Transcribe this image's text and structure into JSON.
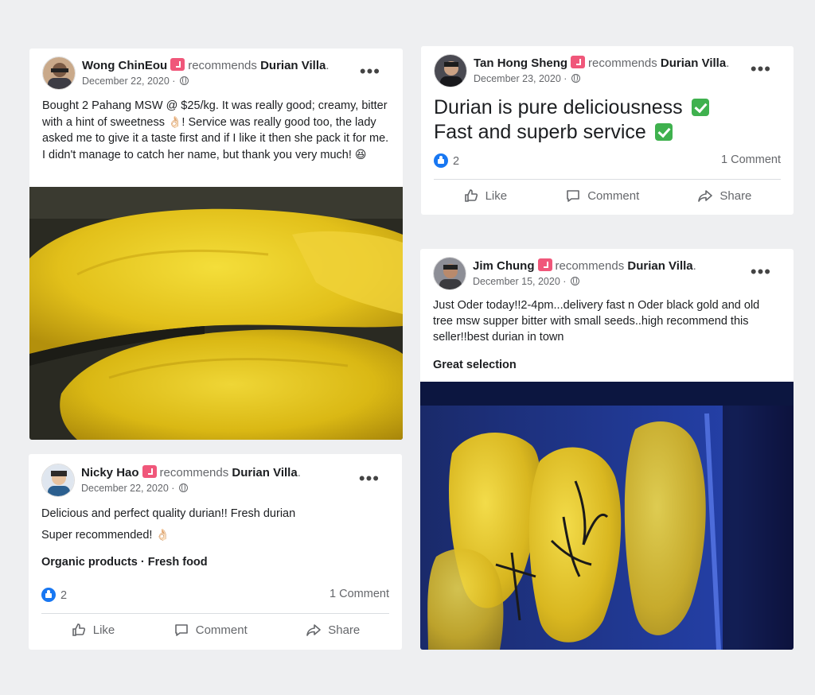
{
  "posts": [
    {
      "author": "Wong ChinEou",
      "recommends": "recommends",
      "page": "Durian Villa",
      "date": "December 22, 2020",
      "text": "Bought 2 Pahang MSW @ $25/kg. It was really good; creamy, bitter with a hint of sweetness",
      "text2": "! Service was really good too, the lady asked me to give it a taste first and if I like it then she pack it for me. I didn't manage to catch her name, but thank you very much!",
      "emoji1": "👌🏻",
      "emoji2": "😆"
    },
    {
      "author": "Tan Hong Sheng",
      "recommends": "recommends",
      "page": "Durian Villa",
      "date": "December 23, 2020",
      "line1": "Durian is pure deliciousness",
      "line2": "Fast and superb service",
      "likes": "2",
      "comments": "1 Comment",
      "like_label": "Like",
      "comment_label": "Comment",
      "share_label": "Share"
    },
    {
      "author": "Jim Chung",
      "recommends": "recommends",
      "page": "Durian Villa",
      "date": "December 15, 2020",
      "text": "Just Oder today!!2-4pm...delivery fast n Oder black gold and old tree msw supper bitter with small seeds..high recommend this seller!!best durian in town",
      "tags": "Great selection"
    },
    {
      "author": "Nicky Hao",
      "recommends": "recommends",
      "page": "Durian Villa",
      "date": "December 22, 2020",
      "line1": "Delicious and perfect quality durian!! Fresh durian",
      "line2": "Super recommended!",
      "emoji": "👌🏻",
      "tags": "Organic products · Fresh food",
      "likes": "2",
      "comments": "1 Comment",
      "like_label": "Like",
      "comment_label": "Comment",
      "share_label": "Share"
    }
  ],
  "colors": {
    "background": "#eeeff1",
    "facebook_blue": "#1877f2",
    "recommend_badge": "#f0577a",
    "check_green": "#3fb14e",
    "durian_yellow": "#e6c619"
  }
}
